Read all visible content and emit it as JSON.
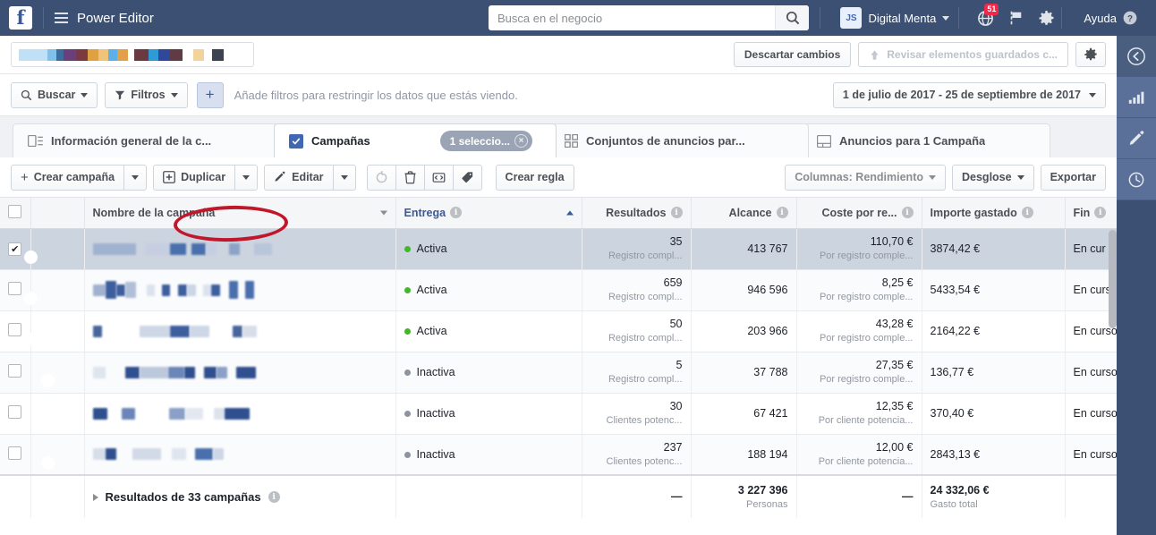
{
  "topnav": {
    "logo": "f",
    "menu_icon": "hamburger-icon",
    "app_title": "Power Editor",
    "search": {
      "placeholder": "Busca en el negocio",
      "value": ""
    },
    "account": {
      "initials": "JS",
      "name": "Digital Menta"
    },
    "notifications_badge": "51",
    "help_label": "Ayuda"
  },
  "toolbar": {
    "account_selector_redacted": true,
    "discard_label": "Descartar cambios",
    "review_label": "Revisar elementos guardados c...",
    "settings_icon": "gear-icon"
  },
  "filterbar": {
    "search_label": "Buscar",
    "filters_label": "Filtros",
    "add_filter_label": "+",
    "hint": "Añade filtros para restringir los datos que estás viendo.",
    "date_range": "1 de julio de 2017 - 25 de septiembre de 2017"
  },
  "tabs": [
    {
      "label": "Información general de la c...",
      "icon": "overview-icon",
      "selected": false
    },
    {
      "label": "Campañas",
      "icon": "checkbox-checked-icon",
      "selected": true,
      "pill": "1 seleccio...",
      "pill_close": "×"
    },
    {
      "label": "Conjuntos de anuncios par...",
      "icon": "adsets-grid-icon",
      "selected": false
    },
    {
      "label": "Anuncios para 1 Campaña",
      "icon": "ad-icon",
      "selected": false
    }
  ],
  "actionbar": {
    "create_label": "Crear campaña",
    "duplicate_label": "Duplicar",
    "edit_label": "Editar",
    "icons": [
      "revert-icon",
      "trash-icon",
      "preview-icon",
      "tag-icon"
    ],
    "create_rule_label": "Crear regla",
    "columns_label": "Columnas: Rendimiento",
    "breakdown_label": "Desglose",
    "export_label": "Exportar",
    "highlight_target": "duplicate_label"
  },
  "rail": [
    {
      "icon": "chevron-left-circle-icon",
      "active": true
    },
    {
      "icon": "bar-chart-icon",
      "active": false
    },
    {
      "icon": "pencil-icon",
      "active": false
    },
    {
      "icon": "clock-icon",
      "active": false
    }
  ],
  "table": {
    "columns": [
      {
        "key": "select",
        "label": ""
      },
      {
        "key": "toggle",
        "label": ""
      },
      {
        "key": "name",
        "label": "Nombre de la campaña",
        "sortable": true
      },
      {
        "key": "delivery",
        "label": "Entrega",
        "sorted": "asc",
        "info": true
      },
      {
        "key": "results",
        "label": "Resultados",
        "info": true
      },
      {
        "key": "reach",
        "label": "Alcance",
        "info": true
      },
      {
        "key": "cost_per_result",
        "label": "Coste por re...",
        "info": true
      },
      {
        "key": "amount_spent",
        "label": "Importe gastado",
        "info": true
      },
      {
        "key": "end",
        "label": "Fin",
        "info": true
      }
    ],
    "rows": [
      {
        "selected": true,
        "checked": true,
        "toggle_on": true,
        "name_redacted": true,
        "delivery": "Activa",
        "delivery_active": true,
        "results": "35",
        "results_sub": "Registro compl...",
        "reach": "413 767",
        "cost_per_result": "110,70 €",
        "cost_sub": "Por registro comple...",
        "amount_spent": "3874,42 €",
        "end": "En cur"
      },
      {
        "selected": false,
        "checked": false,
        "toggle_on": true,
        "name_redacted": true,
        "delivery": "Activa",
        "delivery_active": true,
        "results": "659",
        "results_sub": "Registro compl...",
        "reach": "946 596",
        "cost_per_result": "8,25 €",
        "cost_sub": "Por registro comple...",
        "amount_spent": "5433,54 €",
        "end": "En curso"
      },
      {
        "selected": false,
        "checked": false,
        "toggle_on": true,
        "name_redacted": true,
        "delivery": "Activa",
        "delivery_active": true,
        "results": "50",
        "results_sub": "Registro compl...",
        "reach": "203 966",
        "cost_per_result": "43,28 €",
        "cost_sub": "Por registro comple...",
        "amount_spent": "2164,22 €",
        "end": "En curso"
      },
      {
        "selected": false,
        "checked": false,
        "toggle_on": false,
        "name_redacted": true,
        "delivery": "Inactiva",
        "delivery_active": false,
        "results": "5",
        "results_sub": "Registro compl...",
        "reach": "37 788",
        "cost_per_result": "27,35 €",
        "cost_sub": "Por registro comple...",
        "amount_spent": "136,77 €",
        "end": "En curso"
      },
      {
        "selected": false,
        "checked": false,
        "toggle_on": false,
        "name_redacted": true,
        "delivery": "Inactiva",
        "delivery_active": false,
        "results": "30",
        "results_sub": "Clientes potenc...",
        "reach": "67 421",
        "cost_per_result": "12,35 €",
        "cost_sub": "Por cliente potencia...",
        "amount_spent": "370,40 €",
        "end": "En curso"
      },
      {
        "selected": false,
        "checked": false,
        "toggle_on": false,
        "name_redacted": true,
        "delivery": "Inactiva",
        "delivery_active": false,
        "results": "237",
        "results_sub": "Clientes potenc...",
        "reach": "188 194",
        "cost_per_result": "12,00 €",
        "cost_sub": "Por cliente potencia...",
        "amount_spent": "2843,13 €",
        "end": "En curso"
      }
    ],
    "summary": {
      "label": "Resultados de 33 campañas",
      "results": "—",
      "reach": "3 227 396",
      "reach_sub": "Personas",
      "cost_per_result": "—",
      "amount_spent": "24 332,06 €",
      "amount_sub": "Gasto total"
    }
  },
  "colors": {
    "nav_bg": "#3b5072",
    "accent": "#4267b2",
    "toggle_on": "#1877f2",
    "status_active": "#42b72a",
    "status_inactive": "#8d949e",
    "annotation": "#c0172a",
    "badge": "#f02849"
  }
}
